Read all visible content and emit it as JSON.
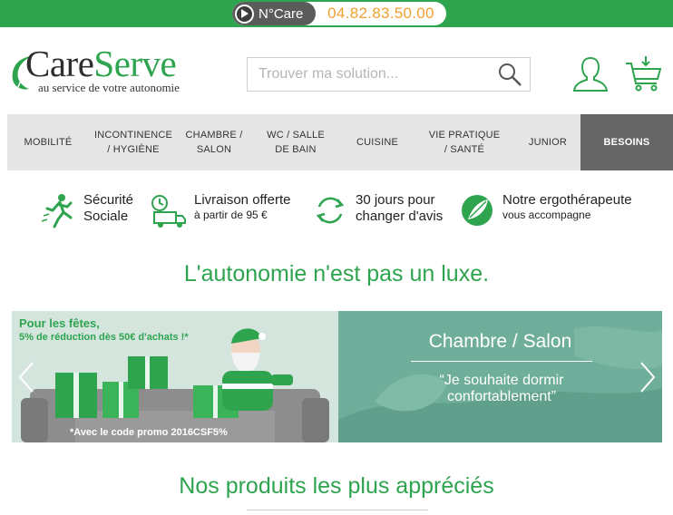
{
  "topbar": {
    "label": "N°Care",
    "phone": "04.82.83.50.00"
  },
  "logo": {
    "care": "Care",
    "serve": "Serve",
    "tagline": "au service de votre autonomie"
  },
  "search": {
    "placeholder": "Trouver ma solution..."
  },
  "nav": {
    "items": [
      {
        "label": "MOBILITÉ"
      },
      {
        "label": "INCONTINENCE\n/ HYGIÈNE"
      },
      {
        "label": "CHAMBRE /\nSALON"
      },
      {
        "label": "WC / SALLE\nDE BAIN"
      },
      {
        "label": "CUISINE"
      },
      {
        "label": "VIE PRATIQUE\n/ SANTÉ"
      },
      {
        "label": "JUNIOR"
      },
      {
        "label": "BESOINS"
      }
    ]
  },
  "reassurance": [
    {
      "title": "Sécurité\nSociale",
      "sub": "",
      "icon": "running-person-icon"
    },
    {
      "title": "Livraison offerte",
      "sub": "à partir de 95 €",
      "icon": "delivery-truck-icon"
    },
    {
      "title": "30 jours pour\nchanger d'avis",
      "sub": "",
      "icon": "refresh-arrows-icon"
    },
    {
      "title": "Notre ergothérapeute",
      "sub": "vous accompagne",
      "icon": "leaf-badge-icon"
    }
  ],
  "tagline": "L'autonomie n'est pas un luxe.",
  "banner_promo": {
    "line1": "Pour les fêtes,",
    "line2": "5% de réduction dès 50€ d'achats !*",
    "code": "*Avec le code promo 2016CSF5%"
  },
  "banner_category": {
    "title": "Chambre / Salon",
    "quote": "“Je souhaite dormir confortablement”"
  },
  "section_title": "Nos produits les plus appréciés",
  "colors": {
    "brand_green": "#2ea44f",
    "phone_orange": "#f0a030",
    "nav_bg": "#e6e6e6",
    "nav_active": "#666666"
  }
}
